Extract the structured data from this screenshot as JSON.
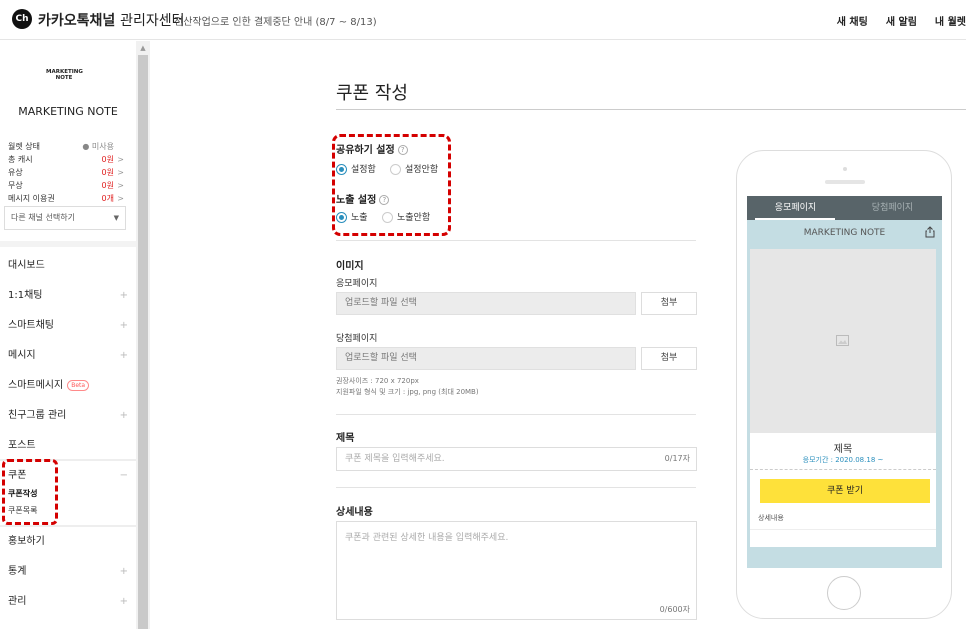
{
  "header": {
    "logo_badge": "Ch",
    "brand_bold": "카카오톡채널",
    "brand_thin": "관리자센터",
    "notice": "전산작업으로 인한 결제중단 안내 (8/7 ~ 8/13)",
    "right_links": [
      "새 채팅",
      "새 알림",
      "내 월렛"
    ]
  },
  "sidebar": {
    "logo_text": "MARKETING NOTE",
    "channel_name": "MARKETING NOTE",
    "stats": [
      {
        "label": "월렛 상태",
        "value": "미사용",
        "tone": "gray",
        "chev": ""
      },
      {
        "label": "총 캐시",
        "value": "0원",
        "tone": "red",
        "chev": ">"
      },
      {
        "label": "유상",
        "value": "0원",
        "tone": "red",
        "chev": ">"
      },
      {
        "label": "무상",
        "value": "0원",
        "tone": "red",
        "chev": ">"
      },
      {
        "label": "메시지 이용권",
        "value": "0개",
        "tone": "red",
        "chev": ">"
      }
    ],
    "channel_select": "다른 채널 선택하기",
    "nav": {
      "dashboard": "대시보드",
      "chat": "1:1채팅",
      "smartchat": "스마트채팅",
      "message": "메시지",
      "smartmessage": "스마트메시지",
      "beta": "Beta",
      "friends": "친구그룹 관리",
      "post": "포스트",
      "coupon": "쿠폰",
      "coupon_create": "쿠폰작성",
      "coupon_list": "쿠폰목록",
      "promote": "홍보하기",
      "stats": "통계",
      "manage": "관리"
    },
    "plus": "+",
    "minus": "−"
  },
  "main": {
    "title": "쿠폰 작성",
    "share_label": "공유하기 설정",
    "share_on": "설정함",
    "share_off": "설정안함",
    "expose_label": "노출 설정",
    "expose_on": "노출",
    "expose_off": "노출안함",
    "help": "?",
    "image_label": "이미지",
    "entry_page_label": "응모페이지",
    "win_page_label": "당첨페이지",
    "file_placeholder": "업로드할 파일 선택",
    "attach": "첨부",
    "hint1": "권장사이즈 : 720 x 720px",
    "hint2": "지원파일 형식 및 크기 : jpg, png (최대 20MB)",
    "title_label": "제목",
    "title_placeholder": "쿠폰 제목을 입력해주세요.",
    "title_count": "0/17자",
    "detail_label": "상세내용",
    "detail_placeholder": "쿠폰과 관련된 상세한 내용을 입력해주세요.",
    "detail_count": "0/600자"
  },
  "preview": {
    "tab_entry": "응모페이지",
    "tab_win": "당첨페이지",
    "channel": "MARKETING NOTE",
    "card_title": "제목",
    "period": "응모기간 : 2020.08.18 ~",
    "coupon_button": "쿠폰 받기",
    "detail": "상세내용"
  },
  "colors": {
    "accent": "#2a8fbd",
    "highlight": "#d40000",
    "coupon_button": "#fee13a",
    "preview_bg": "#c4dde3"
  }
}
